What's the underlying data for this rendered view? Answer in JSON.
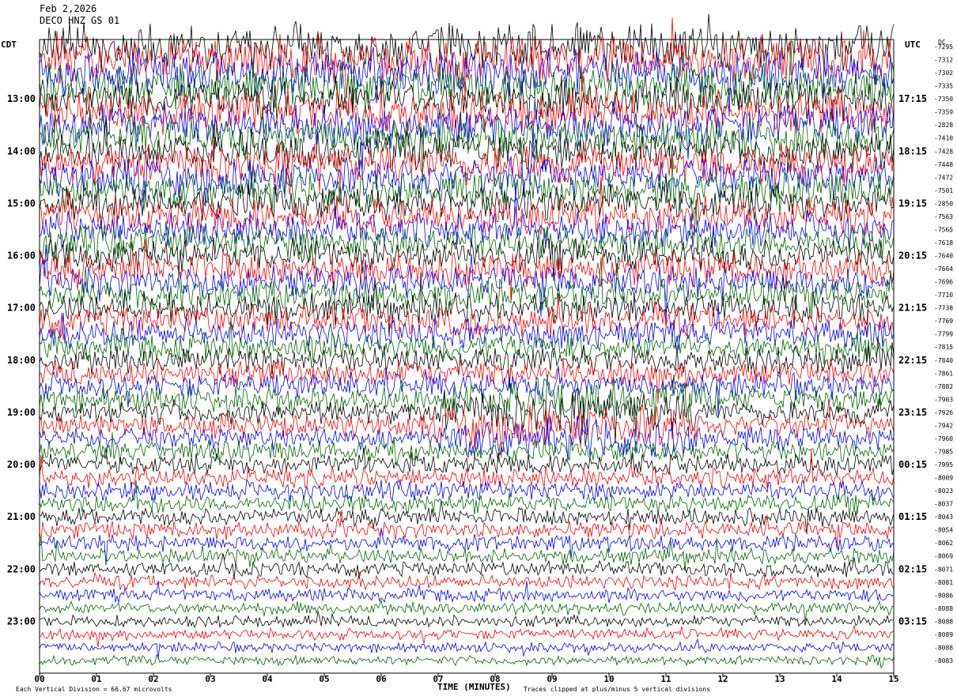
{
  "header": {
    "date": "Feb 2,2026",
    "station": "DECO HNZ GS 01"
  },
  "footer": {
    "scale_note": "Each Vertical Division =   66.67 microvolts",
    "clip_note": "Traces clipped at plus/minus 5 vertical divisions"
  },
  "chart_data": {
    "type": "line",
    "title": "",
    "xlabel": "TIME (MINUTES)",
    "xlim": [
      0,
      15
    ],
    "x_ticks": [
      "00",
      "01",
      "02",
      "03",
      "04",
      "05",
      "06",
      "07",
      "08",
      "09",
      "10",
      "11",
      "12",
      "13",
      "14",
      "15"
    ],
    "left_axis_label": "CDT",
    "right_axis_label": "UTC",
    "dc_label": "DC",
    "left_hour_labels": [
      "13:00",
      "14:00",
      "15:00",
      "16:00",
      "17:00",
      "18:00",
      "19:00",
      "20:00",
      "21:00",
      "22:00",
      "23:00"
    ],
    "right_hour_labels": [
      "17:15",
      "18:15",
      "19:15",
      "20:15",
      "21:15",
      "22:15",
      "23:15",
      "00:15",
      "01:15",
      "02:15",
      "03:15"
    ],
    "trace_colors": [
      "#000000",
      "#ff0000",
      "#0000ff",
      "#006400"
    ],
    "trace_count": 48,
    "dc_offsets": [
      "-7295",
      "-7312",
      "-7302",
      "-7335",
      "-7350",
      "-7359",
      "-2828",
      "-7410",
      "-7428",
      "-7448",
      "-7472",
      "-7501",
      "-2850",
      "-7563",
      "-7565",
      "-7618",
      "-7640",
      "-7664",
      "-7696",
      "-7710",
      "-7738",
      "-7769",
      "-7799",
      "-7815",
      "-7840",
      "-7861",
      "-7882",
      "-7903",
      "-7926",
      "-7942",
      "-7960",
      "-7985",
      "-7995",
      "-8009",
      "-8023",
      "-8037",
      "-8043",
      "-8054",
      "-8062",
      "-8069",
      "-8071",
      "-8081",
      "-8086",
      "-8088",
      "-8088",
      "-8089",
      "-8088",
      "-8083"
    ]
  }
}
